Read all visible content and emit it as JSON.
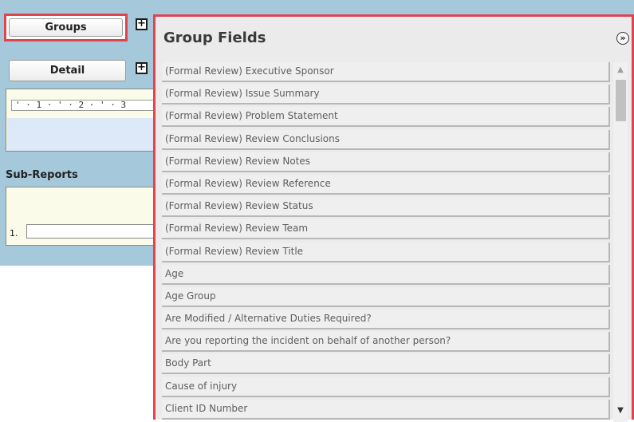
{
  "left_panel": {
    "groups_button": "Groups",
    "groups_add": "+",
    "detail_button": "Detail",
    "detail_add": "+",
    "ruler_text": "' · 1 · ' · 2 · ' · 3",
    "subreports_label": "Sub-Reports",
    "subreport_number": "1."
  },
  "group_fields": {
    "title": "Group Fields",
    "collapse_icon": "double-chevron-down-icon",
    "items": [
      "(Formal Review) Executive Sponsor",
      "(Formal Review) Issue Summary",
      "(Formal Review) Problem Statement",
      "(Formal Review) Review Conclusions",
      "(Formal Review) Review Notes",
      "(Formal Review) Review Reference",
      "(Formal Review) Review Status",
      "(Formal Review) Review Team",
      "(Formal Review) Review Title",
      "Age",
      "Age Group",
      "Are Modified / Alternative Duties Required?",
      "Are you reporting the incident on behalf of another person?",
      "Body Part",
      "Cause of injury",
      "Client ID Number"
    ]
  },
  "colors": {
    "highlight_border": "#e0454f",
    "designer_background": "#a5c8da",
    "detail_band": "#dde9f9",
    "report_area": "#fbfbea"
  }
}
